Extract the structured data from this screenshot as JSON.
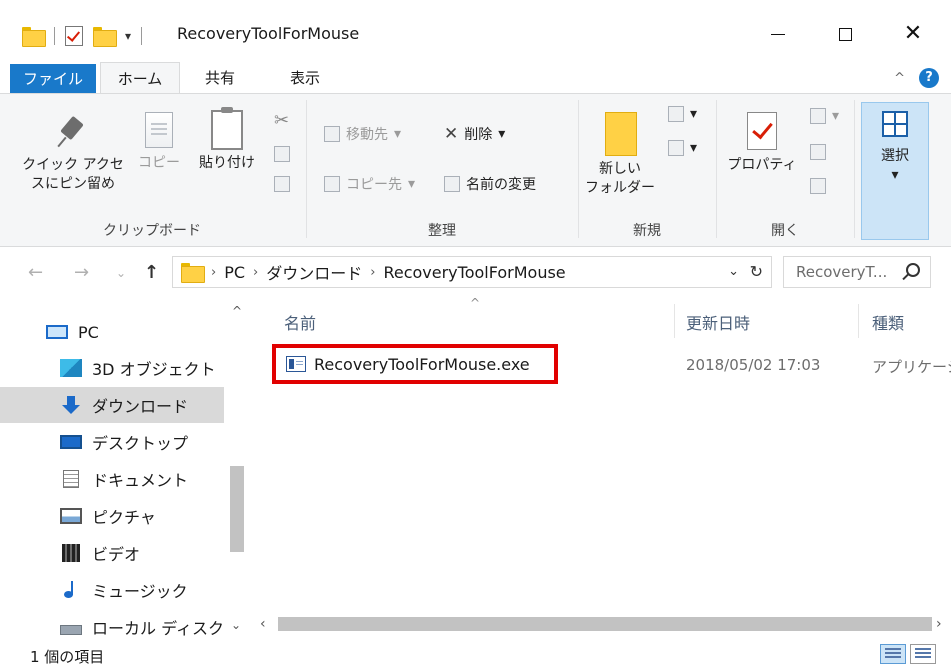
{
  "window": {
    "title": "RecoveryToolForMouse",
    "qat_dropdown_glyph": "▾",
    "close_glyph": "✕"
  },
  "ribbon_tabs": {
    "file": "ファイル",
    "home": "ホーム",
    "share": "共有",
    "view": "表示"
  },
  "ribbon": {
    "clipboard": {
      "group_label": "クリップボード",
      "pin_label": "クイック アクセスにピン留め",
      "pin_line1": "クイック アクセ",
      "pin_line2": "スにピン留め",
      "copy_label": "コピー",
      "paste_label": "貼り付け"
    },
    "organize": {
      "group_label": "整理",
      "move_to": "移動先",
      "delete": "削除",
      "copy_to": "コピー先",
      "rename": "名前の変更"
    },
    "new": {
      "group_label": "新規",
      "new_folder_line1": "新しい",
      "new_folder_line2": "フォルダー"
    },
    "open": {
      "group_label": "開く",
      "properties": "プロパティ"
    },
    "select": {
      "label": "選択"
    }
  },
  "address_bar": {
    "crumbs": [
      "PC",
      "ダウンロード",
      "RecoveryToolForMouse"
    ],
    "search_placeholder": "RecoveryT..."
  },
  "nav_pane": {
    "items": [
      {
        "label": "PC",
        "icon": "pc-icon"
      },
      {
        "label": "3D オブジェクト",
        "icon": "3d-objects-icon"
      },
      {
        "label": "ダウンロード",
        "icon": "download-icon",
        "selected": true
      },
      {
        "label": "デスクトップ",
        "icon": "desktop-icon"
      },
      {
        "label": "ドキュメント",
        "icon": "documents-icon"
      },
      {
        "label": "ピクチャ",
        "icon": "pictures-icon"
      },
      {
        "label": "ビデオ",
        "icon": "videos-icon"
      },
      {
        "label": "ミュージック",
        "icon": "music-icon"
      },
      {
        "label": "ローカル ディスク (C",
        "icon": "local-disk-icon"
      }
    ]
  },
  "file_list": {
    "columns": {
      "name": "名前",
      "modified": "更新日時",
      "type": "種類"
    },
    "rows": [
      {
        "name": "RecoveryToolForMouse.exe",
        "modified": "2018/05/02 17:03",
        "type": "アプリケーション",
        "type_visible": "アプリケーシ",
        "highlighted": true
      }
    ]
  },
  "status_bar": {
    "item_count": "1 個の項目"
  },
  "colors": {
    "file_tab": "#1979ca",
    "highlight_box": "#e10000",
    "nav_selected": "#d9d9d9",
    "select_button": "#cce4f7"
  }
}
